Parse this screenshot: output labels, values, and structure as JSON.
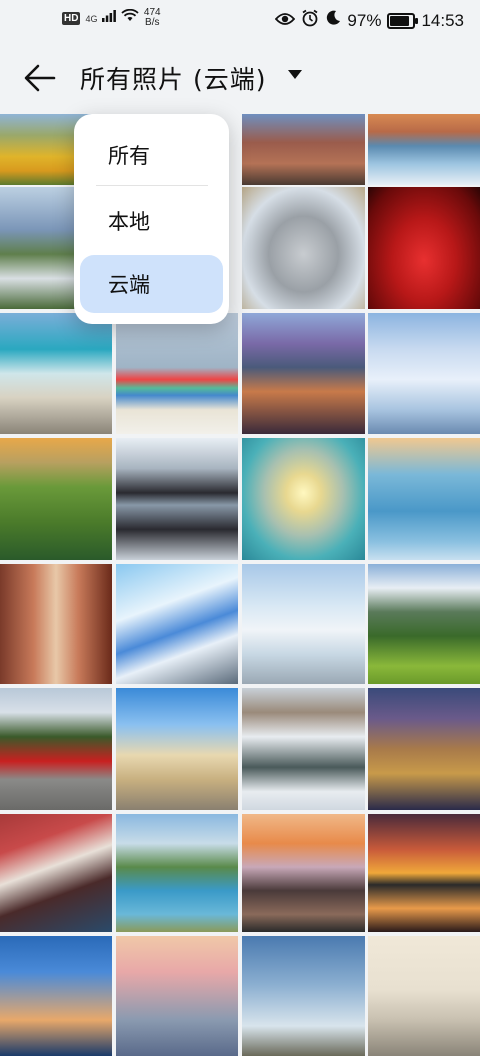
{
  "status_bar": {
    "hd": "HD",
    "network": "4G",
    "speed_value": "474",
    "speed_unit": "B/s",
    "battery": "97%",
    "battery_level": 0.97,
    "time": "14:53"
  },
  "header": {
    "title": "所有照片 (云端)"
  },
  "filter_menu": {
    "items": [
      {
        "label": "所有"
      },
      {
        "label": "本地"
      },
      {
        "label": "云端",
        "selected": true
      }
    ]
  },
  "photos": {
    "rows": [
      [
        "landscape-flowers",
        "hidden",
        "parliament-building",
        "ocean-rocks"
      ],
      [
        "stadium-coast",
        "hidden",
        "silver-suv",
        "red-sports-car"
      ],
      [
        "penguin-beach",
        "beach-huts",
        "mountain-city-dusk",
        "snowy-forest"
      ],
      [
        "green-river-valley",
        "modern-building-reflection",
        "sunrise-ice-lake",
        "ice-castle"
      ],
      [
        "ornate-hall",
        "wave-architecture",
        "frozen-pavilion",
        "alpine-meadow"
      ],
      [
        "red-hatchback",
        "palace-square",
        "snowy-peaks",
        "gothic-town-night"
      ],
      [
        "coastal-rocks",
        "mountain-lake",
        "rocky-shore-sunset",
        "sunset-lake"
      ],
      [
        "skyscraper-dusk",
        "pagoda-mountains",
        "village-cloudy",
        "chateau"
      ]
    ]
  }
}
